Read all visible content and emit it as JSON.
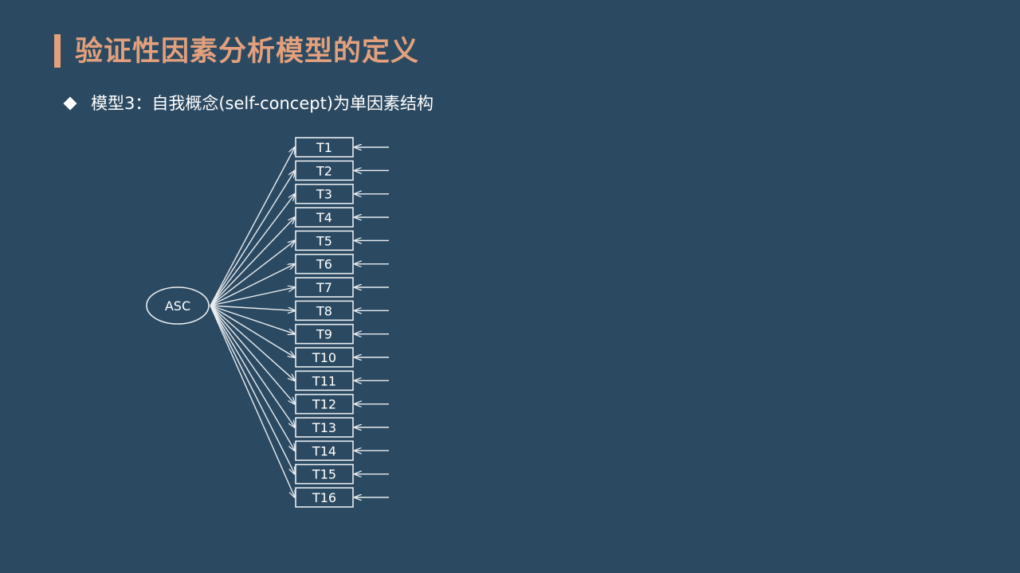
{
  "slide": {
    "title": "验证性因素分析模型的定义",
    "bullet": "模型3：自我概念(self-concept)为单因素结构"
  },
  "diagram": {
    "factor": "ASC",
    "indicators": [
      "T1",
      "T2",
      "T3",
      "T4",
      "T5",
      "T6",
      "T7",
      "T8",
      "T9",
      "T10",
      "T11",
      "T12",
      "T13",
      "T14",
      "T15",
      "T16"
    ]
  },
  "colors": {
    "background": "#2b4a62",
    "accent": "#e3a07c",
    "foreground": "#ffffff",
    "line": "#e8ecef"
  }
}
